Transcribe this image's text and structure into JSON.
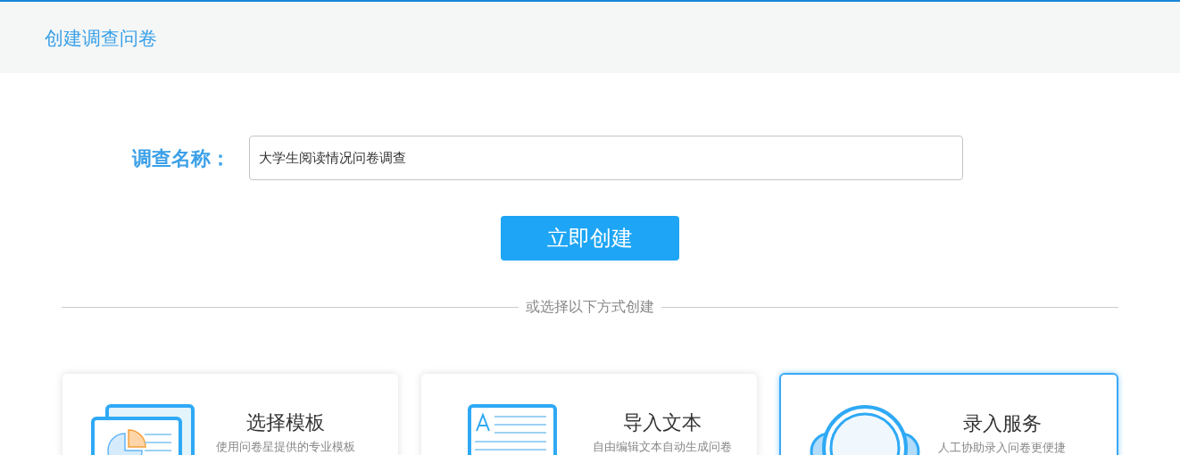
{
  "header": {
    "title": "创建调查问卷"
  },
  "form": {
    "label": "调查名称：",
    "name_field": {
      "value": "大学生阅读情况问卷调查"
    },
    "submit": "立即创建"
  },
  "divider_text": "或选择以下方式创建",
  "options": [
    {
      "kind": "template",
      "title": "选择模板",
      "description": "使用问卷星提供的专业模板",
      "selected": false
    },
    {
      "kind": "import",
      "title": "导入文本",
      "description": "自由编辑文本自动生成问卷",
      "selected": false
    },
    {
      "kind": "service",
      "title": "录入服务",
      "description": "人工协助录入问卷更便捷",
      "selected": true
    }
  ]
}
